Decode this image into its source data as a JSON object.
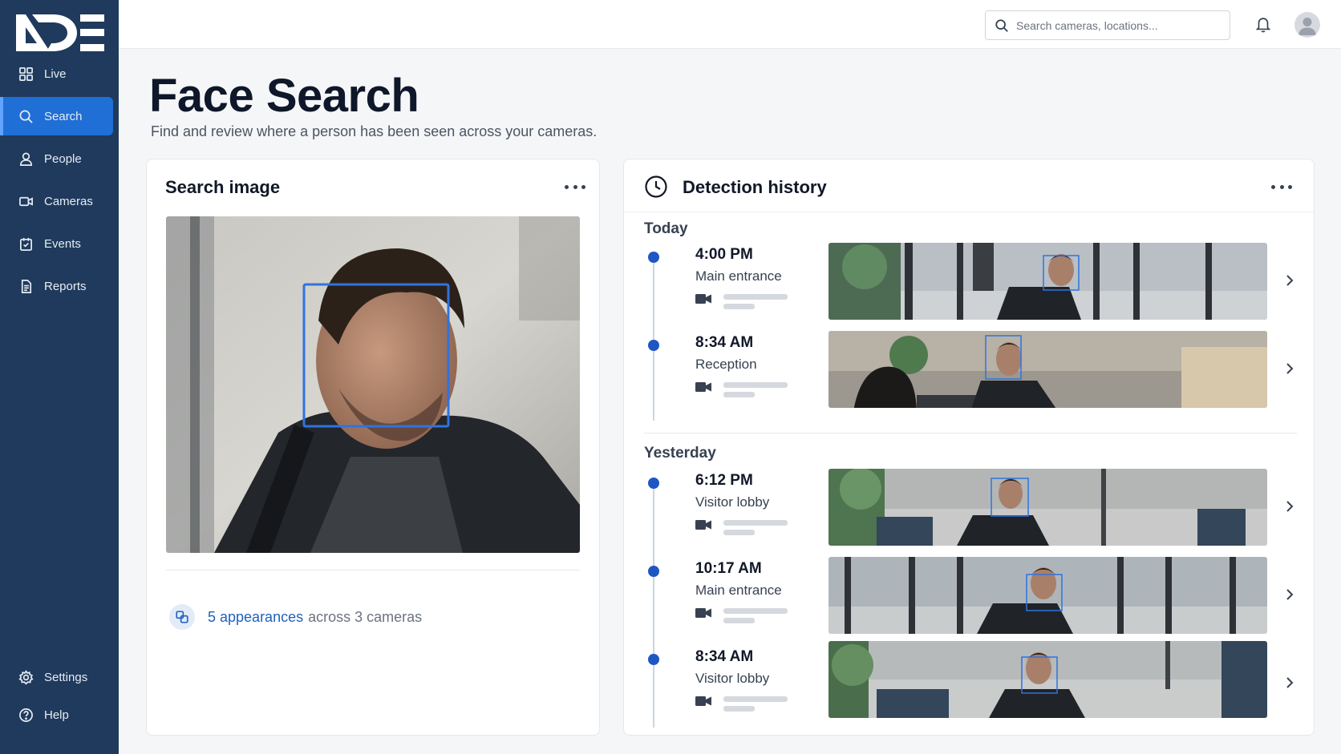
{
  "logo": {
    "text": "NDE"
  },
  "sidebar": {
    "items": [
      {
        "label": "Live",
        "icon": "grid-icon"
      },
      {
        "label": "Search",
        "icon": "search-icon",
        "active": true
      },
      {
        "label": "People",
        "icon": "person-icon"
      },
      {
        "label": "Cameras",
        "icon": "camera-icon"
      },
      {
        "label": "Events",
        "icon": "calendar-icon"
      },
      {
        "label": "Reports",
        "icon": "document-icon"
      }
    ],
    "bottom_items": [
      {
        "label": "Settings",
        "icon": "gear-icon"
      },
      {
        "label": "Help",
        "icon": "help-icon"
      }
    ]
  },
  "topbar": {
    "search_placeholder": "Search cameras, locations..."
  },
  "page": {
    "title": "Face Search",
    "subtitle": "Find and review where a person has been seen across your cameras."
  },
  "search_card": {
    "title": "Search image",
    "appearances_link": "5 appearances",
    "appearances_suffix": "across 3 cameras"
  },
  "history_card": {
    "title": "Detection history",
    "groups": [
      {
        "day": "Today",
        "detections": [
          {
            "time": "4:00 PM",
            "location": "Main entrance"
          },
          {
            "time": "8:34 AM",
            "location": "Reception"
          }
        ]
      },
      {
        "day": "Yesterday",
        "detections": [
          {
            "time": "6:12 PM",
            "location": "Visitor lobby"
          },
          {
            "time": "10:17 AM",
            "location": "Main entrance"
          },
          {
            "time": "8:34 AM",
            "location": "Visitor lobby"
          }
        ]
      }
    ]
  },
  "colors": {
    "sidebar_bg": "#1f3a5c",
    "active_nav": "#1f6fd6",
    "accent": "#1f5fbf",
    "face_box": "#2f73e0",
    "timeline_dot": "#1e56c4"
  }
}
